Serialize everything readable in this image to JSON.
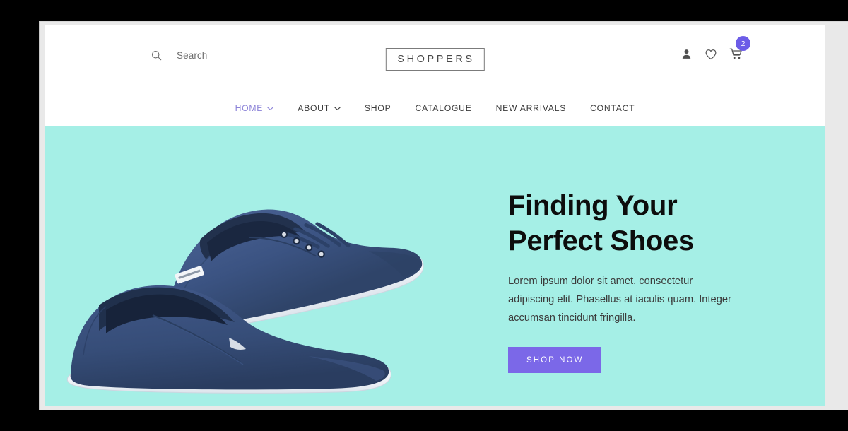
{
  "header": {
    "search": {
      "icon": "search-icon",
      "label": "Search",
      "placeholder": "Search"
    },
    "brand": "SHOPPERS",
    "actions": [
      {
        "icon": "user-icon",
        "name": "account"
      },
      {
        "icon": "heart-icon",
        "name": "wishlist"
      },
      {
        "icon": "cart-icon",
        "name": "cart"
      }
    ],
    "cart_badge_count": "2",
    "cart_badge_color": "#6c5ce7"
  },
  "nav": {
    "items": [
      {
        "label": "HOME",
        "active": true,
        "has_dropdown": true
      },
      {
        "label": "ABOUT",
        "active": false,
        "has_dropdown": true
      },
      {
        "label": "SHOP",
        "active": false,
        "has_dropdown": false
      },
      {
        "label": "CATALOGUE",
        "active": false,
        "has_dropdown": false
      },
      {
        "label": "NEW ARRIVALS",
        "active": false,
        "has_dropdown": false
      },
      {
        "label": "CONTACT",
        "active": false,
        "has_dropdown": false
      }
    ],
    "active_color": "#8b82d8",
    "text_color": "#3a3a3a"
  },
  "hero": {
    "background_color": "#a5efe6",
    "heading_line1": "Finding Your",
    "heading_line2": "Perfect Shoes",
    "paragraph": "Lorem ipsum dolor sit amet, consectetur adipiscing elit. Phasellus at iaculis quam. Integer accumsan tincidunt fringilla.",
    "cta_label": "SHOP NOW",
    "cta_color": "#7b68e8",
    "image": {
      "name": "navy-canvas-sneakers",
      "shoe_color": "#3b5382",
      "sole_color": "#f4f7fa"
    }
  }
}
